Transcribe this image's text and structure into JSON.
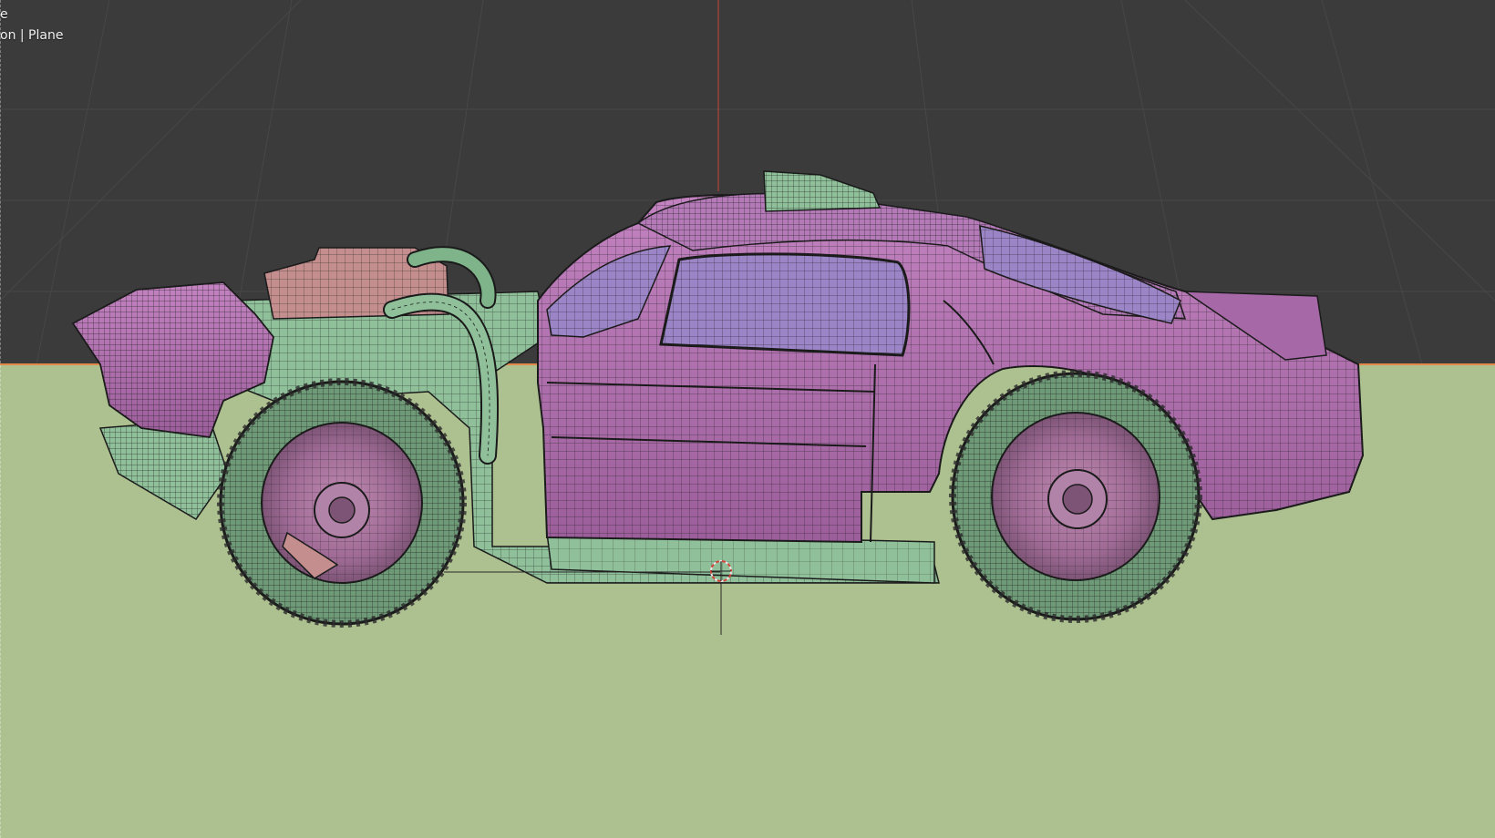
{
  "viewport": {
    "overlay_line1": "e",
    "overlay_line2": "on | Plane"
  },
  "scene": {
    "object_name": "car",
    "cursor_icon": "3d-cursor-icon",
    "colors": {
      "background": "#3b3b3b",
      "grid": "#454545",
      "ground_plane": "#adc08f",
      "horizon_line": "#e2884b",
      "car_body": "#b975b7",
      "car_body_dark": "#8a4f8a",
      "car_glass": "#9b85c7",
      "chassis": "#8fc09a",
      "tire": "#6f9a78",
      "wheel_rim": "#a7749a",
      "engine": "#c48e8e",
      "wire": "#1a1a1a",
      "axis_red": "#d2453a"
    }
  }
}
